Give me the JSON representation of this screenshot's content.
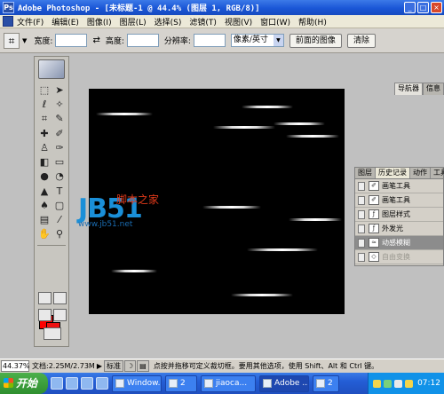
{
  "titlebar": {
    "app_icon": "Ps",
    "title": "Adobe Photoshop - [未标题-1 @ 44.4% (图层 1, RGB/8)]",
    "buttons": [
      "_",
      "□",
      "×"
    ]
  },
  "menubar": {
    "items": [
      "文件(F)",
      "编辑(E)",
      "图像(I)",
      "图层(L)",
      "选择(S)",
      "滤镜(T)",
      "视图(V)",
      "窗口(W)",
      "帮助(H)"
    ]
  },
  "options": {
    "tool_icon": "crop-icon",
    "width_label": "宽度:",
    "width_value": "",
    "height_label": "高度:",
    "height_value": "",
    "resolution_label": "分辨率:",
    "resolution_value": "",
    "unit_select": "像素/英寸",
    "front_image_button": "前面的图像",
    "clear_button": "清除"
  },
  "panels": {
    "navigator_tabs": [
      "导航器",
      "信息"
    ],
    "history": {
      "tabs": [
        "图层",
        "历史记录",
        "动作",
        "工具"
      ],
      "items": [
        {
          "label": "画笔工具",
          "state": "normal"
        },
        {
          "label": "画笔工具",
          "state": "normal"
        },
        {
          "label": "图层样式",
          "state": "normal"
        },
        {
          "label": "外发光",
          "state": "normal"
        },
        {
          "label": "动感模糊",
          "state": "active"
        },
        {
          "label": "自由变换",
          "state": "dim"
        }
      ]
    }
  },
  "watermark": {
    "logo": "JB51",
    "cn_text": "脚本之家",
    "url": "www.jb51.net"
  },
  "status": {
    "zoom": "44.37%",
    "doc_size": "文档:2.25M/2.73M",
    "mode_label": "标准",
    "hint": "点按并拖移可定义裁切框。要用其他选项，使用 Shift、Alt 和 Ctrl 键。"
  },
  "colors": {
    "foreground": "#ff0000",
    "background": "#ee1111",
    "canvas": "#000000"
  },
  "taskbar": {
    "start_label": "开始",
    "buttons": [
      {
        "label": "Window...",
        "active": false
      },
      {
        "label": "2",
        "active": false
      },
      {
        "label": "jiaoca...",
        "active": false
      },
      {
        "label": "Adobe ...",
        "active": true
      },
      {
        "label": "2",
        "active": false
      }
    ],
    "clock": "07:12"
  }
}
